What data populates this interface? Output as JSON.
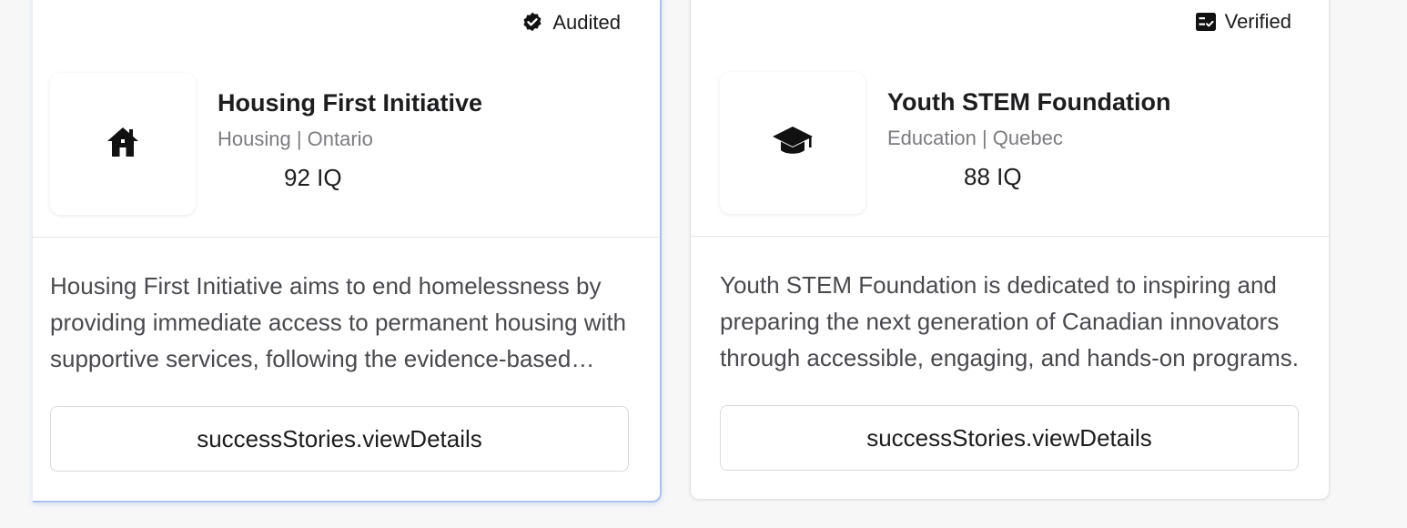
{
  "cards": [
    {
      "badge": {
        "label": "Audited",
        "icon": "verified-seal-icon"
      },
      "logo_icon": "home-icon",
      "name": "Housing First Initiative",
      "meta": "Housing | Ontario",
      "iq": "92 IQ",
      "description": "Housing First Initiative aims to end homelessness by providing immediate access to permanent housing with supportive services, following the evidence-based Housing First model.",
      "button_label": "successStories.viewDetails"
    },
    {
      "badge": {
        "label": "Verified",
        "icon": "checklist-icon"
      },
      "logo_icon": "graduation-cap-icon",
      "name": "Youth STEM Foundation",
      "meta": "Education | Quebec",
      "iq": "88 IQ",
      "description": "Youth STEM Foundation is dedicated to inspiring and preparing the next generation of Canadian innovators through accessible, engaging, and hands-on programs.",
      "button_label": "successStories.viewDetails"
    }
  ],
  "colors": {
    "selected_border": "#a9c1ef",
    "text_primary": "#1d1d1f",
    "text_muted": "#7c7c80"
  }
}
